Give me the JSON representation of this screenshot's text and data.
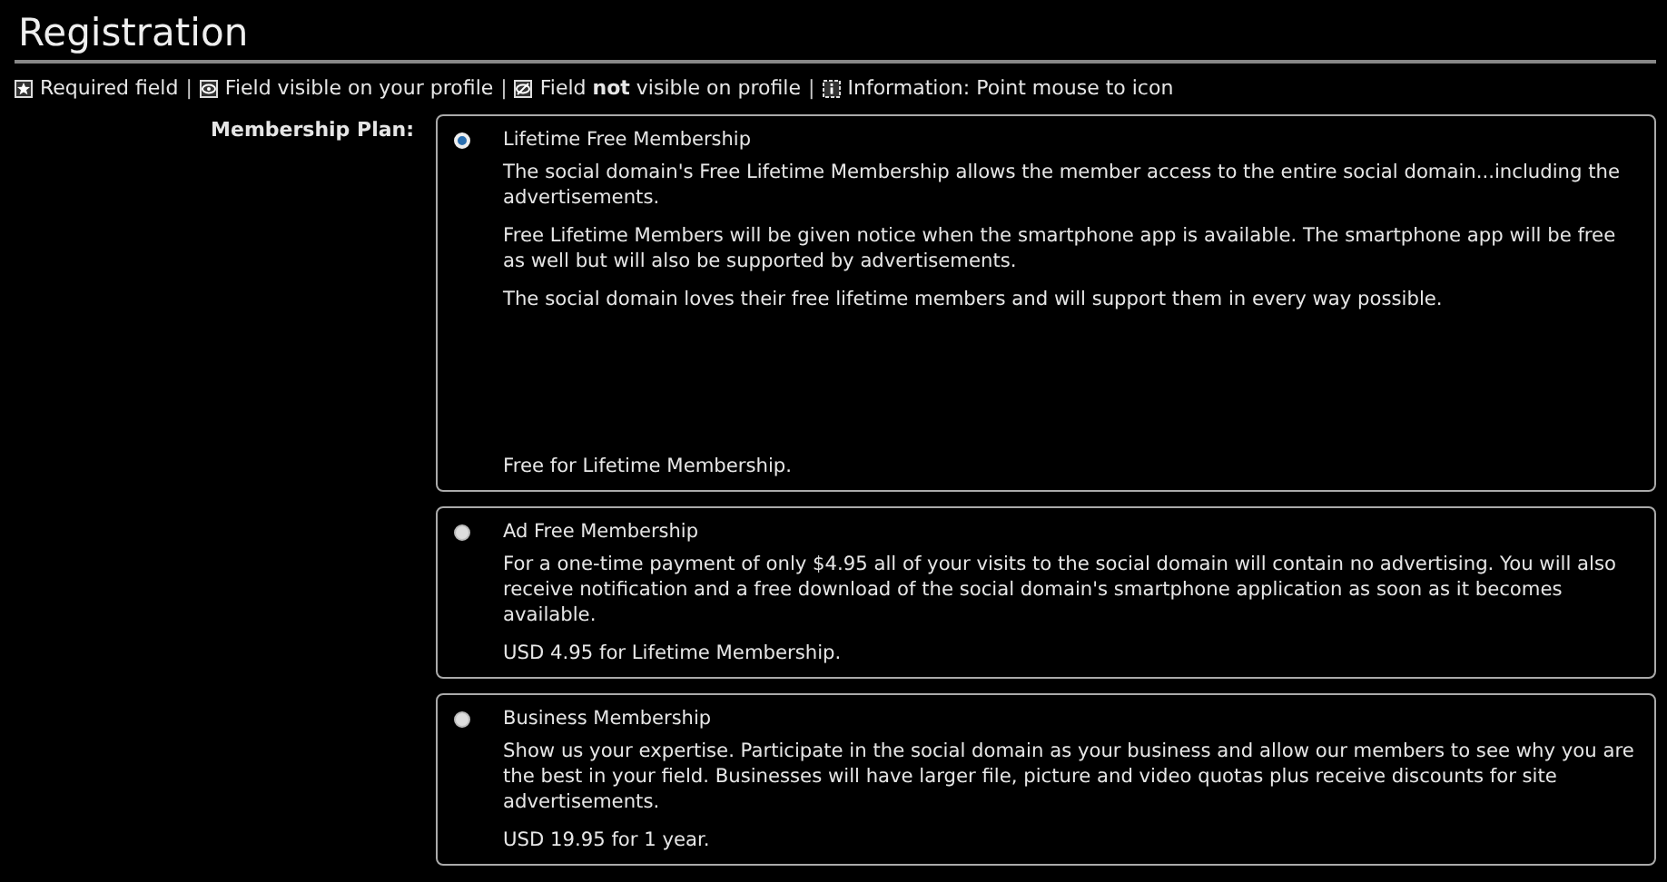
{
  "title": "Registration",
  "legend": {
    "separator": "|",
    "items": [
      {
        "kind": "required",
        "text": "Required field"
      },
      {
        "kind": "visible",
        "text": "Field visible on your profile"
      },
      {
        "kind": "hidden",
        "text": "Field **not** visible on profile"
      },
      {
        "kind": "info",
        "text": "Information: Point mouse to icon"
      }
    ]
  },
  "membership_plan": {
    "label": "Membership Plan:",
    "plans": [
      {
        "name": "Lifetime Free Membership",
        "selected": true,
        "description": [
          "The social domain's Free Lifetime Membership allows  the member access to the entire social domain...including the advertisements.",
          "Free Lifetime Members will be given notice when the smartphone app is available. The smartphone app will be free as well but will also be supported by advertisements.",
          "The social domain loves their free lifetime members and will support them in every way possible."
        ],
        "price": "Free for Lifetime Membership."
      },
      {
        "name": "Ad Free Membership",
        "selected": false,
        "description": [
          "For a one-time payment of only $4.95 all of your visits to the social domain will contain no advertising. You will also receive notification and a free download of the social domain's smartphone application as soon as it becomes available."
        ],
        "price": "USD 4.95 for Lifetime Membership."
      },
      {
        "name": "Business Membership",
        "selected": false,
        "description": [
          "Show us your expertise. Participate in the social domain as your business and allow our members to see why you are the best in your field. Businesses will have larger file, picture and video quotas plus receive discounts for site advertisements."
        ],
        "price": "USD 19.95 for 1 year."
      }
    ]
  }
}
